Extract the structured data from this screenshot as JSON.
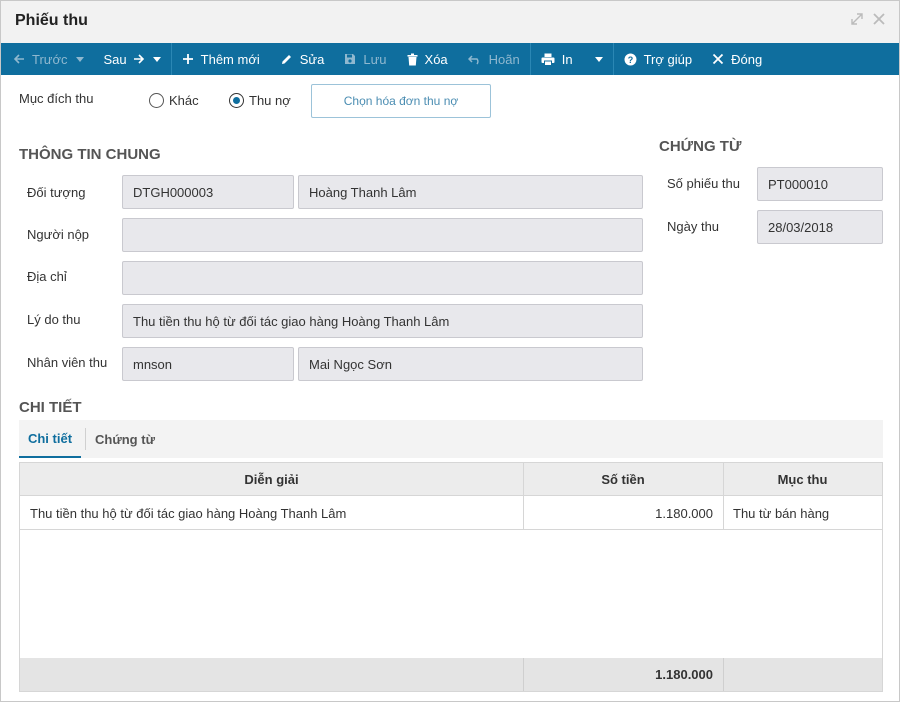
{
  "window": {
    "title": "Phiếu thu",
    "icons": [
      "expand-icon",
      "close-icon"
    ]
  },
  "toolbar": {
    "prev_label": "Trước",
    "next_label": "Sau",
    "add_label": "Thêm mới",
    "edit_label": "Sửa",
    "save_label": "Lưu",
    "delete_label": "Xóa",
    "undo_label": "Hoãn",
    "print_label": "In",
    "help_label": "Trợ giúp",
    "close_label": "Đóng",
    "bg_color": "#0f6e9e",
    "disabled_color": "#8fb8cf"
  },
  "purpose": {
    "label": "Mục đích thu",
    "options": [
      {
        "label": "Khác",
        "checked": false
      },
      {
        "label": "Thu nợ",
        "checked": true
      }
    ],
    "choose_button": "Chọn hóa đơn thu nợ"
  },
  "general": {
    "title": "THÔNG TIN CHUNG",
    "fields": {
      "object_label": "Đối tượng",
      "object_code": "DTGH000003",
      "object_name": "Hoàng Thanh Lâm",
      "payer_label": "Người nộp",
      "payer_value": "",
      "address_label": "Địa chỉ",
      "address_value": "",
      "reason_label": "Lý do thu",
      "reason_value": "Thu tiền thu hộ từ đối tác giao hàng Hoàng Thanh Lâm",
      "staff_label": "Nhân viên thu",
      "staff_code": "mnson",
      "staff_name": "Mai Ngọc Sơn"
    }
  },
  "voucher": {
    "title": "CHỨNG TỪ",
    "number_label": "Số phiếu thu",
    "number_value": "PT000010",
    "date_label": "Ngày thu",
    "date_value": "28/03/2018"
  },
  "detail": {
    "title": "CHI TIẾT",
    "tabs": [
      {
        "label": "Chi tiết",
        "active": true
      },
      {
        "label": "Chứng từ",
        "active": false
      }
    ],
    "columns": [
      "Diễn giải",
      "Số tiền",
      "Mục thu"
    ],
    "rows": [
      {
        "description": "Thu tiền thu hộ từ đối tác giao hàng Hoàng Thanh Lâm",
        "amount": "1.180.000",
        "category": "Thu từ bán hàng"
      }
    ],
    "total_amount": "1.180.000"
  }
}
